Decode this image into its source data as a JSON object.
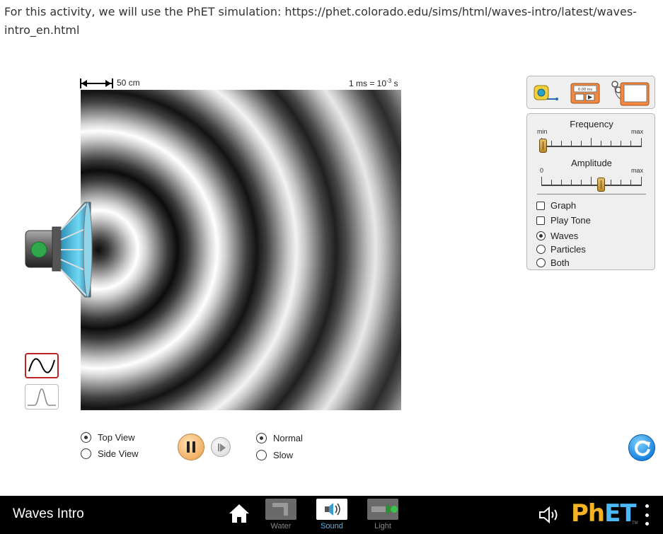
{
  "intro": {
    "text": "For this activity, we will use the PhET simulation: https://phet.colorado.edu/sims/html/waves-intro/latest/waves-intro_en.html"
  },
  "sim": {
    "length_scale_label": "50 cm",
    "time_scale_prefix": "1 ms = 10",
    "time_scale_exponent": "-3",
    "time_scale_suffix": " s",
    "tools": [
      {
        "name": "measuring-tape",
        "icon": "tape-measure-icon"
      },
      {
        "name": "stopwatch",
        "icon": "stopwatch-icon",
        "readout": "0.00 ms"
      },
      {
        "name": "wave-meter",
        "icon": "wave-meter-icon"
      }
    ],
    "frequency": {
      "title": "Frequency",
      "min_label": "min",
      "max_label": "max",
      "value_fraction": 0.02
    },
    "amplitude": {
      "title": "Amplitude",
      "min_label": "0",
      "max_label": "max",
      "value_fraction": 0.6
    },
    "checkboxes": [
      {
        "label": "Graph",
        "checked": false
      },
      {
        "label": "Play Tone",
        "checked": false
      }
    ],
    "view_modes": [
      {
        "label": "Waves",
        "selected": true
      },
      {
        "label": "Particles",
        "selected": false
      },
      {
        "label": "Both",
        "selected": false
      }
    ],
    "wave_types": [
      {
        "name": "continuous-wave",
        "icon": "sine-wave-icon",
        "selected": true
      },
      {
        "name": "pulse-wave",
        "icon": "pulse-wave-icon",
        "selected": false
      }
    ],
    "viewpoints": [
      {
        "label": "Top View",
        "selected": true
      },
      {
        "label": "Side View",
        "selected": false
      }
    ],
    "speeds": [
      {
        "label": "Normal",
        "selected": true
      },
      {
        "label": "Slow",
        "selected": false
      }
    ],
    "accent_color": "#f2b065",
    "reset_color": "#1b86e0"
  },
  "navbar": {
    "title": "Waves Intro",
    "screens": [
      {
        "label": "Water",
        "active": false
      },
      {
        "label": "Sound",
        "active": true
      },
      {
        "label": "Light",
        "active": false
      }
    ],
    "logo_left": "Ph",
    "logo_right": "ET",
    "logo_tm": "TM"
  }
}
